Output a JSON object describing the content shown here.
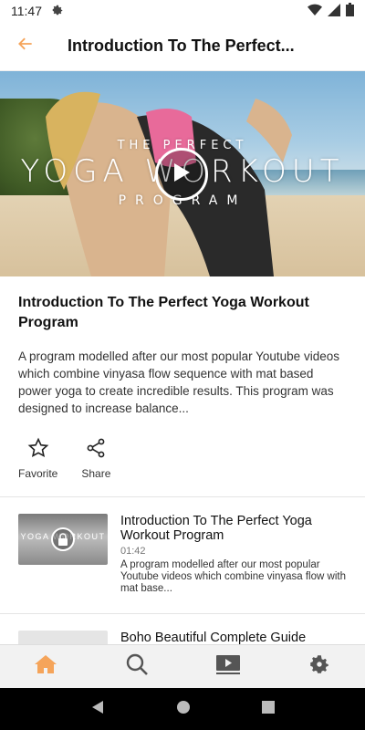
{
  "status_bar": {
    "time": "11:47"
  },
  "app_bar": {
    "title": "Introduction To The Perfect..."
  },
  "hero": {
    "overlay_line1": "THE PERFECT",
    "overlay_line2": "YOGA WORKOUT",
    "overlay_line3": "PROGRAM"
  },
  "details": {
    "title": "Introduction To The Perfect Yoga Workout Program",
    "description": "A program modelled after our most popular Youtube videos which combine vinyasa flow sequence with mat based power yoga to create incredible results. This program was designed to increase balance...",
    "favorite_label": "Favorite",
    "share_label": "Share"
  },
  "videos": [
    {
      "title": "Introduction To The Perfect Yoga Workout Program",
      "duration": "01:42",
      "description": "A program modelled after our most popular Youtube videos which combine vinyasa flow with mat base...",
      "thumb_text": "YOGA WORKOUT"
    },
    {
      "title": "Boho Beautiful Complete Guide"
    }
  ],
  "colors": {
    "accent": "#f5a45a",
    "nav_bg": "#f2f2f2",
    "icon_gray": "#555555"
  },
  "icons": {
    "back": "arrow-left-icon",
    "play": "play-icon",
    "favorite": "star-outline-icon",
    "share": "share-icon",
    "home": "home-icon",
    "search": "search-icon",
    "video": "video-library-icon",
    "settings": "gear-icon"
  }
}
